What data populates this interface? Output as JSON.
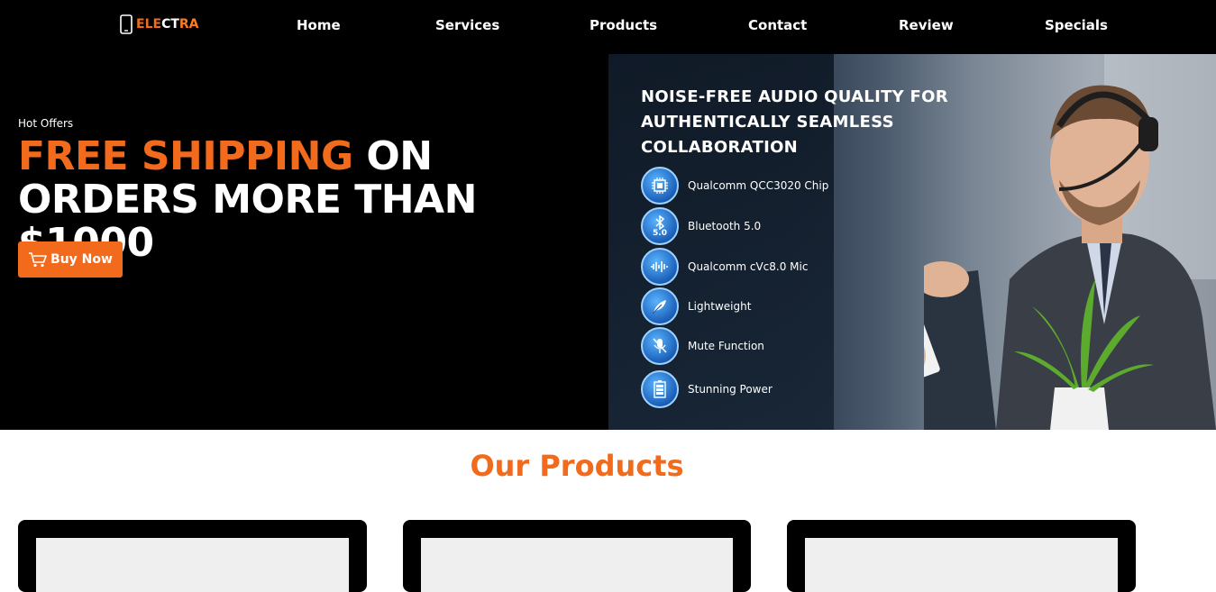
{
  "brand": {
    "part1": "ELE",
    "part2": "CT",
    "part3": "RA"
  },
  "nav": {
    "items": [
      {
        "label": "Home"
      },
      {
        "label": "Services"
      },
      {
        "label": "Products"
      },
      {
        "label": "Contact"
      },
      {
        "label": "Review"
      },
      {
        "label": "Specials"
      }
    ]
  },
  "hero": {
    "eyebrow": "Hot Offers",
    "headline_accent": "FREE SHIPPING",
    "headline_rest": " ON ORDERS MORE THAN $1000",
    "cta_label": "Buy Now",
    "cta_icon": "cart-icon"
  },
  "banner": {
    "title": "NOISE-FREE AUDIO QUALITY FOR AUTHENTICALLY SEAMLESS COLLABORATION",
    "features": [
      {
        "label": "Qualcomm QCC3020 Chip",
        "icon": "chip-icon"
      },
      {
        "label": "Bluetooth 5.0",
        "icon": "bluetooth-icon"
      },
      {
        "label": "Qualcomm cVc8.0 Mic",
        "icon": "soundwave-icon"
      },
      {
        "label": "Lightweight",
        "icon": "feather-icon"
      },
      {
        "label": "Mute Function",
        "icon": "mic-mute-icon"
      },
      {
        "label": "Stunning Power",
        "icon": "battery-icon"
      }
    ],
    "bluetooth_badge": "5.0"
  },
  "products": {
    "title": "Our Products"
  },
  "colors": {
    "accent": "#f26b1d",
    "nav_bg": "#000000",
    "hero_bg": "#000000"
  }
}
